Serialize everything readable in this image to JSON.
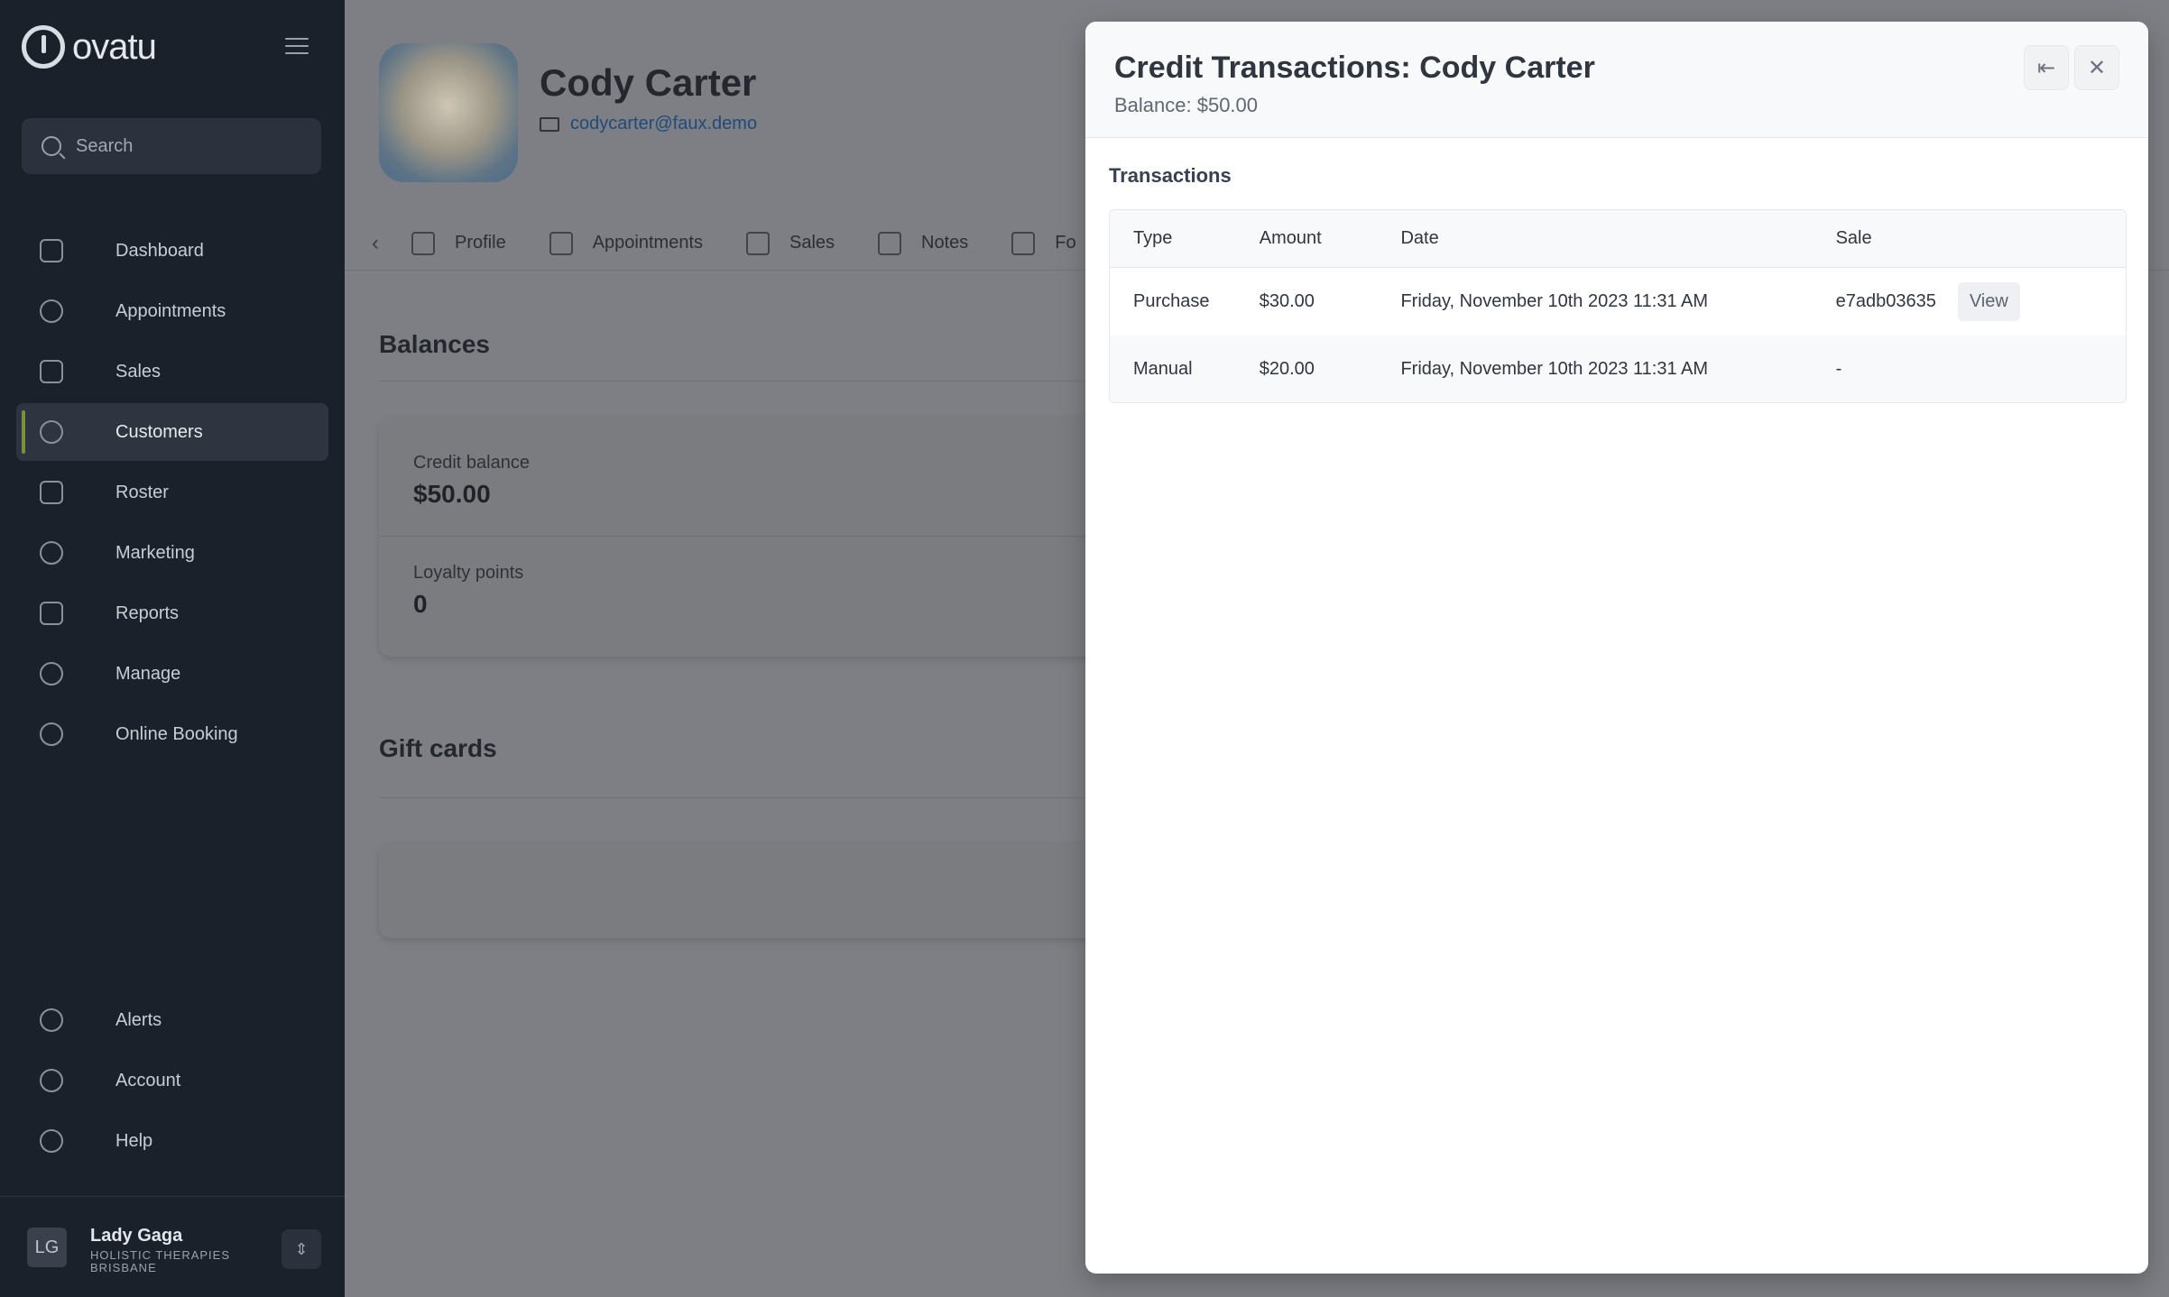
{
  "app": {
    "brand": "ovatu",
    "search_placeholder": "Search"
  },
  "sidebar": {
    "items": [
      {
        "label": "Dashboard",
        "icon": "home-icon"
      },
      {
        "label": "Appointments",
        "icon": "clock-icon"
      },
      {
        "label": "Sales",
        "icon": "tag-icon"
      },
      {
        "label": "Customers",
        "icon": "users-icon",
        "active": true
      },
      {
        "label": "Roster",
        "icon": "calendar-icon"
      },
      {
        "label": "Marketing",
        "icon": "megaphone-icon"
      },
      {
        "label": "Reports",
        "icon": "chart-icon"
      },
      {
        "label": "Manage",
        "icon": "gear-icon"
      },
      {
        "label": "Online Booking",
        "icon": "globe-icon"
      }
    ],
    "bottom_items": [
      {
        "label": "Alerts",
        "icon": "bell-icon"
      },
      {
        "label": "Account",
        "icon": "account-icon"
      },
      {
        "label": "Help",
        "icon": "help-icon"
      }
    ],
    "user": {
      "initials": "LG",
      "name": "Lady Gaga",
      "org": "HOLISTIC THERAPIES BRISBANE"
    }
  },
  "customer": {
    "name": "Cody Carter",
    "email": "codycarter@faux.demo",
    "tabs": [
      "Profile",
      "Appointments",
      "Sales",
      "Notes",
      "Fo"
    ]
  },
  "balances": {
    "title": "Balances",
    "credit_label": "Credit balance",
    "credit_value": "$50.00",
    "loyalty_label": "Loyalty points",
    "loyalty_value": "0"
  },
  "giftcards": {
    "title": "Gift cards"
  },
  "modal": {
    "title": "Credit Transactions: Cody Carter",
    "balance": "Balance: $50.00",
    "section_label": "Transactions",
    "columns": {
      "type": "Type",
      "amount": "Amount",
      "date": "Date",
      "sale": "Sale"
    },
    "rows": [
      {
        "type": "Purchase",
        "amount": "$30.00",
        "date": "Friday, November 10th 2023 11:31 AM",
        "sale": "e7adb03635",
        "action": "View"
      },
      {
        "type": "Manual",
        "amount": "$20.00",
        "date": "Friday, November 10th 2023 11:31 AM",
        "sale": "-"
      }
    ]
  }
}
